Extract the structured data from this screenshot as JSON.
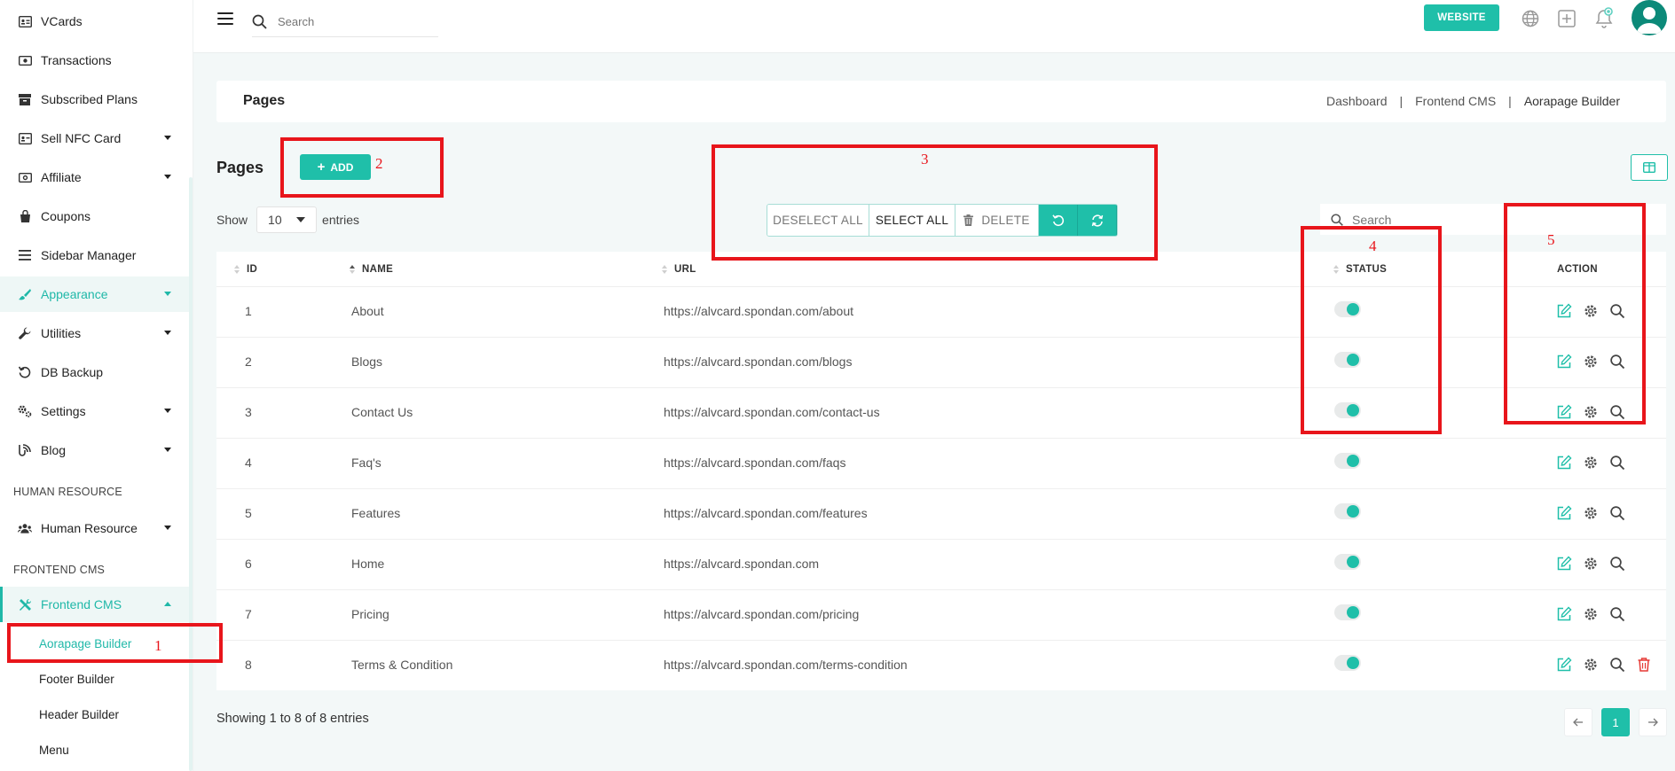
{
  "sidebar": {
    "items": [
      {
        "label": "VCards",
        "icon": "vcard-icon"
      },
      {
        "label": "Transactions",
        "icon": "money-icon"
      },
      {
        "label": "Subscribed Plans",
        "icon": "archive-icon"
      },
      {
        "label": "Sell NFC Card",
        "icon": "card-icon"
      },
      {
        "label": "Affiliate",
        "icon": "cash-icon"
      },
      {
        "label": "Coupons",
        "icon": "bag-icon"
      },
      {
        "label": "Sidebar Manager",
        "icon": "list-icon"
      },
      {
        "label": "Appearance",
        "icon": "brush-icon"
      },
      {
        "label": "Utilities",
        "icon": "wrench-icon"
      },
      {
        "label": "DB Backup",
        "icon": "history-icon"
      },
      {
        "label": "Settings",
        "icon": "gears-icon"
      },
      {
        "label": "Blog",
        "icon": "blog-icon"
      },
      {
        "label": "Human Resource",
        "icon": "users-icon"
      },
      {
        "label": "Frontend CMS",
        "icon": "tools-icon"
      }
    ],
    "sections": {
      "human_resource": "HUMAN RESOURCE",
      "frontend_cms": "FRONTEND CMS"
    },
    "sub_items": [
      "Aorapage Builder",
      "Footer Builder",
      "Header Builder",
      "Menu"
    ]
  },
  "topbar": {
    "search_placeholder": "Search",
    "website_label": "WEBSITE"
  },
  "header": {
    "title": "Pages",
    "breadcrumbs": [
      "Dashboard",
      "Frontend CMS",
      "Aorapage Builder"
    ]
  },
  "main": {
    "title": "Pages",
    "add_label": "ADD",
    "show_label": "Show",
    "page_size": "10",
    "entries_label": "entries",
    "bulk": {
      "deselect": "DESELECT ALL",
      "select": "SELECT ALL",
      "delete": "DELETE"
    },
    "search_placeholder": "Search",
    "columns": {
      "id": "ID",
      "name": "NAME",
      "url": "URL",
      "status": "STATUS",
      "action": "ACTION"
    },
    "rows": [
      {
        "id": "1",
        "name": "About",
        "url": "https://alvcard.spondan.com/about"
      },
      {
        "id": "2",
        "name": "Blogs",
        "url": "https://alvcard.spondan.com/blogs"
      },
      {
        "id": "3",
        "name": "Contact Us",
        "url": "https://alvcard.spondan.com/contact-us"
      },
      {
        "id": "4",
        "name": "Faq's",
        "url": "https://alvcard.spondan.com/faqs"
      },
      {
        "id": "5",
        "name": "Features",
        "url": "https://alvcard.spondan.com/features"
      },
      {
        "id": "6",
        "name": "Home",
        "url": "https://alvcard.spondan.com"
      },
      {
        "id": "7",
        "name": "Pricing",
        "url": "https://alvcard.spondan.com/pricing"
      },
      {
        "id": "8",
        "name": "Terms & Condition",
        "url": "https://alvcard.spondan.com/terms-condition"
      }
    ],
    "showing": "Showing 1 to 8 of 8 entries",
    "current_page": "1"
  },
  "annotations": [
    "1",
    "2",
    "3",
    "4",
    "5"
  ],
  "colors": {
    "accent": "#1fbfa9",
    "annotation": "#e8151b",
    "danger": "#e53935"
  }
}
